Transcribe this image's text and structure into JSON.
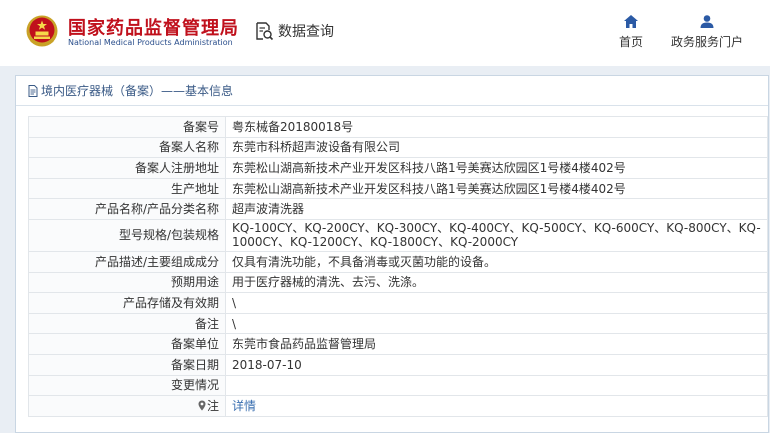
{
  "header": {
    "org_name_cn": "国家药品监督管理局",
    "org_name_en": "National Medical Products Administration",
    "data_query_label": "数据查询",
    "nav": {
      "home_label": "首页",
      "gov_services_label": "政务服务门户"
    }
  },
  "panel": {
    "title": "境内医疗器械（备案）——基本信息",
    "rows": [
      {
        "label": "备案号",
        "value": "粤东械备20180018号"
      },
      {
        "label": "备案人名称",
        "value": "东莞市科桥超声波设备有限公司"
      },
      {
        "label": "备案人注册地址",
        "value": "东莞松山湖高新技术产业开发区科技八路1号美赛达欣园区1号楼4楼402号"
      },
      {
        "label": "生产地址",
        "value": "东莞松山湖高新技术产业开发区科技八路1号美赛达欣园区1号楼4楼402号"
      },
      {
        "label": "产品名称/产品分类名称",
        "value": "超声波清洗器"
      },
      {
        "label": "型号规格/包装规格",
        "value": "KQ-100CY、KQ-200CY、KQ-300CY、KQ-400CY、KQ-500CY、KQ-600CY、KQ-800CY、KQ-1000CY、KQ-1200CY、KQ-1800CY、KQ-2000CY"
      },
      {
        "label": "产品描述/主要组成成分",
        "value": "仅具有清洗功能，不具备消毒或灭菌功能的设备。"
      },
      {
        "label": "预期用途",
        "value": "用于医疗器械的清洗、去污、洗涤。"
      },
      {
        "label": "产品存储及有效期",
        "value": "\\"
      },
      {
        "label": "备注",
        "value": "\\"
      },
      {
        "label": "备案单位",
        "value": "东莞市食品药品监督管理局"
      },
      {
        "label": "备案日期",
        "value": "2018-07-10"
      },
      {
        "label": "变更情况",
        "value": ""
      }
    ],
    "note_label": "注",
    "detail_link": "详情"
  },
  "colors": {
    "brand_red": "#c0101c",
    "brand_blue": "#2b4f8c",
    "link_blue": "#3a6fb0",
    "band_bg": "#e9eef4"
  }
}
